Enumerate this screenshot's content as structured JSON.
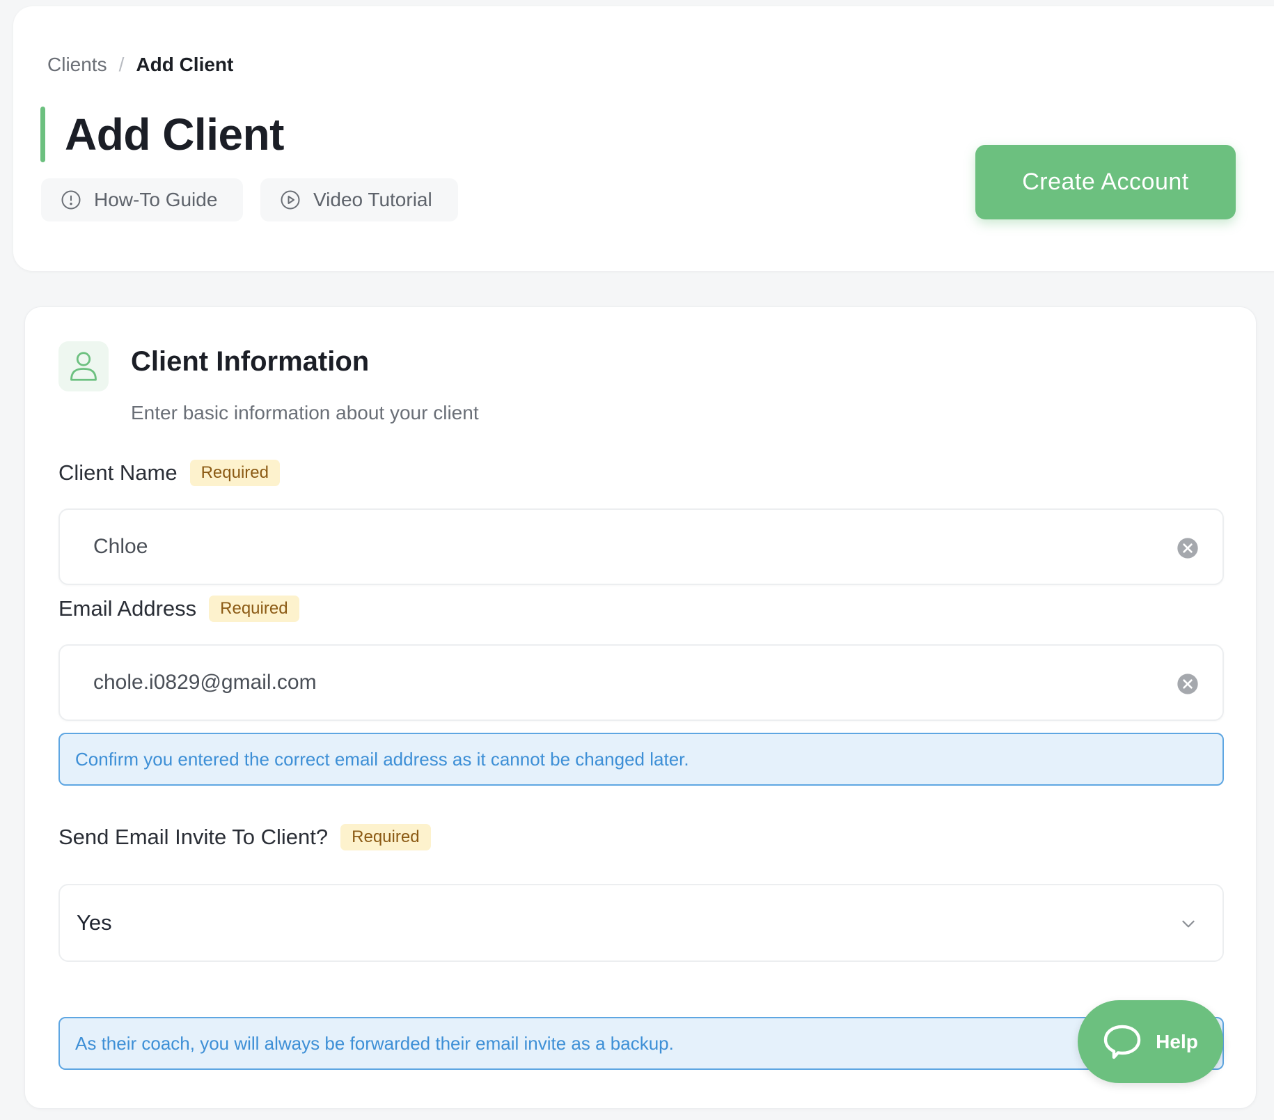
{
  "breadcrumb": {
    "parent": "Clients",
    "separator": "/",
    "current": "Add Client"
  },
  "header": {
    "title": "Add Client",
    "guide_label": "How-To Guide",
    "video_label": "Video Tutorial",
    "create_label": "Create Account"
  },
  "section": {
    "title": "Client Information",
    "subtitle": "Enter basic information about your client"
  },
  "fields": {
    "name": {
      "label": "Client Name",
      "badge": "Required",
      "value": "Chloe"
    },
    "email": {
      "label": "Email Address",
      "badge": "Required",
      "value": "chole.i0829@gmail.com"
    },
    "email_note": "Confirm you entered the correct email address as it cannot be changed later.",
    "invite": {
      "label": "Send Email Invite To Client?",
      "badge": "Required",
      "selected": "Yes"
    },
    "invite_note": "As their coach, you will always be forwarded their email invite as a backup."
  },
  "help": {
    "label": "Help"
  },
  "icons": {
    "guide": "info-circle-icon",
    "video": "play-circle-icon",
    "section": "user-icon",
    "clear": "clear-circle-icon",
    "dropdown": "chevron-down-icon",
    "help": "chat-bubble-icon"
  },
  "colors": {
    "accent": "#6cc07f",
    "required_bg": "#fdf2cd",
    "required_text": "#8b5a14",
    "info_bg": "#e5f1fb",
    "info_border": "#5ea6e2",
    "info_text": "#3d8fd6"
  }
}
